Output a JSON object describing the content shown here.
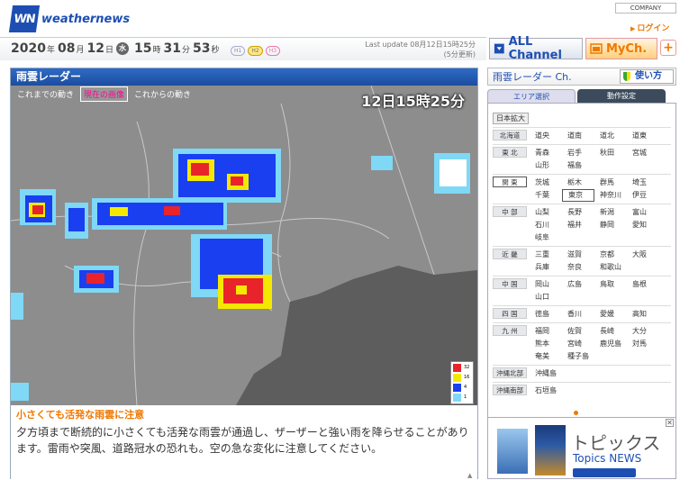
{
  "header": {
    "logo_mark": "WN",
    "logo_text": "weathernews",
    "company": "COMPANY",
    "login": "ログイン"
  },
  "datebar": {
    "year": "2020",
    "year_unit": "年",
    "month": "08",
    "month_unit": "月",
    "day": "12",
    "day_unit": "日",
    "dow": "水",
    "hour": "15",
    "hour_unit": "時",
    "minute": "31",
    "minute_unit": "分",
    "second": "53",
    "second_unit": "秒",
    "hbtns": [
      "H1",
      "H2",
      "H3"
    ],
    "update_line1": "Last update  08月12日15時25分",
    "update_line2": "(5分更新)"
  },
  "channels": {
    "all": "ALL Channel",
    "my": "MyCh.",
    "plus": "+"
  },
  "panel": {
    "title": "雨雲レーダー",
    "tabs": [
      "これまでの動き",
      "現在の画像",
      "これからの動き"
    ],
    "map_time": "12日15時25分",
    "legend": [
      "32",
      "16",
      "4",
      "1"
    ],
    "headline": "小さくても活発な雨雲に注意",
    "body": "夕方頃まで断続的に小さくても活発な雨雲が通過し、ザーザーと強い雨を降らせることがあります。雷雨や突風、道路冠水の恐れも。空の急な変化に注意してください。"
  },
  "right": {
    "title": "雨雲レーダー Ch.",
    "howto": "使い方",
    "tab_area": "エリア選択",
    "tab_settings": "動作設定",
    "zoom": "日本拡大",
    "regions": [
      {
        "label": "北海道",
        "prefs": [
          "道央",
          "道南",
          "道北",
          "道東"
        ]
      },
      {
        "label": "東 北",
        "prefs": [
          "青森",
          "岩手",
          "秋田",
          "宮城",
          "山形",
          "福島"
        ]
      },
      {
        "label": "関 東",
        "prefs": [
          "茨城",
          "栃木",
          "群馬",
          "埼玉",
          "千葉",
          "東京",
          "神奈川",
          "伊豆"
        ]
      },
      {
        "label": "中 部",
        "prefs": [
          "山梨",
          "長野",
          "新潟",
          "富山",
          "石川",
          "福井",
          "静岡",
          "愛知",
          "岐阜"
        ]
      },
      {
        "label": "近 畿",
        "prefs": [
          "三重",
          "滋賀",
          "京都",
          "大阪",
          "兵庫",
          "奈良",
          "和歌山"
        ]
      },
      {
        "label": "中 国",
        "prefs": [
          "岡山",
          "広島",
          "鳥取",
          "島根",
          "山口"
        ]
      },
      {
        "label": "四 国",
        "prefs": [
          "徳島",
          "香川",
          "愛媛",
          "高知"
        ]
      },
      {
        "label": "九 州",
        "prefs": [
          "福岡",
          "佐賀",
          "長崎",
          "大分",
          "熊本",
          "宮崎",
          "鹿児島",
          "対馬",
          "奄美",
          "種子島"
        ]
      },
      {
        "label": "沖縄北部",
        "prefs": [
          "沖縄島"
        ]
      },
      {
        "label": "沖縄南部",
        "prefs": [
          "石垣島"
        ]
      }
    ],
    "selected_region": "関 東",
    "selected_pref": "東京"
  },
  "topics": {
    "jp": "トピックス",
    "en": "Topics NEWS",
    "close": "✕"
  },
  "colors": {
    "brand": "#1d4fb2",
    "accent": "#f07800",
    "radar_light": "#7fd8f6",
    "radar_mid": "#1a3ff0",
    "radar_yellow": "#f5e800",
    "radar_red": "#e8242a"
  }
}
